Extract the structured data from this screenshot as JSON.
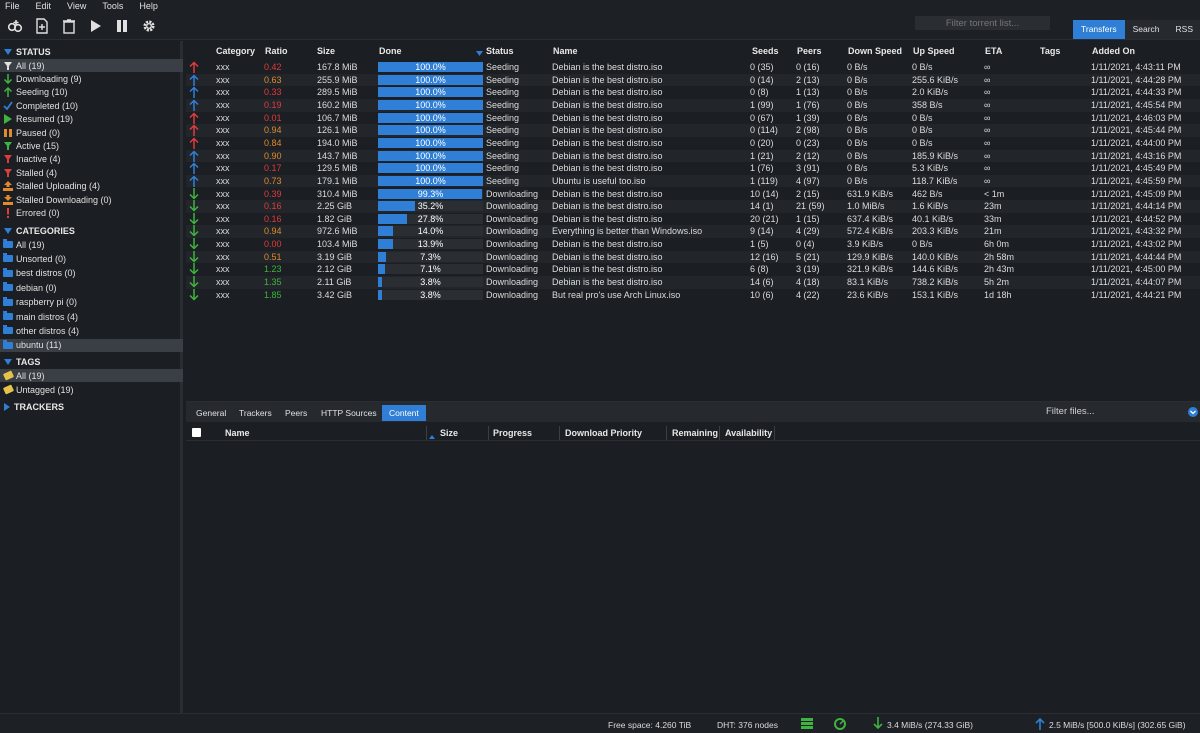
{
  "menu": [
    "File",
    "Edit",
    "View",
    "Tools",
    "Help"
  ],
  "toolbar": {
    "icons": [
      "add-link-icon",
      "add-file-icon",
      "delete-icon",
      "play-icon",
      "pause-icon",
      "settings-icon"
    ],
    "filter_placeholder": "Filter torrent list...",
    "tabs": [
      "Transfers",
      "Search",
      "RSS"
    ],
    "active_tab": "Transfers"
  },
  "sidebar": {
    "status_header": "STATUS",
    "status": [
      {
        "label": "All (19)",
        "icon": "filter-icon",
        "color": "#e0e0e0",
        "selected": true
      },
      {
        "label": "Downloading (9)",
        "icon": "arrow-down-icon",
        "color": "#3fb33f"
      },
      {
        "label": "Seeding (10)",
        "icon": "arrow-up-icon",
        "color": "#3fb33f"
      },
      {
        "label": "Completed (10)",
        "icon": "check-icon",
        "color": "#2f7fd6"
      },
      {
        "label": "Resumed (19)",
        "icon": "play-icon",
        "color": "#3fb33f"
      },
      {
        "label": "Paused (0)",
        "icon": "pause-icon",
        "color": "#e08a2b"
      },
      {
        "label": "Active (15)",
        "icon": "filter-icon",
        "color": "#3fb33f"
      },
      {
        "label": "Inactive (4)",
        "icon": "filter-icon",
        "color": "#e03c3c"
      },
      {
        "label": "Stalled (4)",
        "icon": "filter-icon",
        "color": "#e03c3c"
      },
      {
        "label": "Stalled Uploading (4)",
        "icon": "stalled-up-icon",
        "color": "#e08a2b"
      },
      {
        "label": "Stalled Downloading (0)",
        "icon": "stalled-down-icon",
        "color": "#e08a2b"
      },
      {
        "label": "Errored (0)",
        "icon": "error-icon",
        "color": "#e03c3c"
      }
    ],
    "categories_header": "CATEGORIES",
    "categories": [
      {
        "label": "All (19)"
      },
      {
        "label": "Unsorted (0)"
      },
      {
        "label": "best distros (0)"
      },
      {
        "label": "debian (0)"
      },
      {
        "label": "raspberry pi (0)"
      },
      {
        "label": "main distros (4)"
      },
      {
        "label": "other distros (4)"
      },
      {
        "label": "ubuntu (11)",
        "selected": true
      }
    ],
    "tags_header": "TAGS",
    "tags": [
      {
        "label": "All (19)",
        "selected": true
      },
      {
        "label": "Untagged (19)"
      }
    ],
    "trackers_header": "TRACKERS"
  },
  "table": {
    "headers": [
      "Category",
      "Ratio",
      "Size",
      "Done",
      "Status",
      "Name",
      "Seeds",
      "Peers",
      "Down Speed",
      "Up Speed",
      "ETA",
      "Tags",
      "Added On"
    ],
    "rows": [
      {
        "dir": "up",
        "arrow": "#e03c3c",
        "cat": "xxx",
        "ratio": "0.42",
        "rc": "#e03c3c",
        "size": "167.8 MiB",
        "done": 100.0,
        "done_t": "100.0%",
        "status": "Seeding",
        "name": "Debian is the best distro.iso",
        "seeds": "0 (35)",
        "peers": "0 (16)",
        "down": "0 B/s",
        "up": "0 B/s",
        "eta": "∞",
        "added": "1/11/2021, 4:43:11 PM"
      },
      {
        "dir": "up",
        "arrow": "#2f7fd6",
        "cat": "xxx",
        "ratio": "0.63",
        "rc": "#e08a2b",
        "size": "255.9 MiB",
        "done": 100.0,
        "done_t": "100.0%",
        "status": "Seeding",
        "name": "Debian is the best distro.iso",
        "seeds": "0 (14)",
        "peers": "2 (13)",
        "down": "0 B/s",
        "up": "255.6 KiB/s",
        "eta": "∞",
        "added": "1/11/2021, 4:44:28 PM"
      },
      {
        "dir": "up",
        "arrow": "#2f7fd6",
        "cat": "xxx",
        "ratio": "0.33",
        "rc": "#e03c3c",
        "size": "289.5 MiB",
        "done": 100.0,
        "done_t": "100.0%",
        "status": "Seeding",
        "name": "Debian is the best distro.iso",
        "seeds": "0 (8)",
        "peers": "1 (13)",
        "down": "0 B/s",
        "up": "2.0 KiB/s",
        "eta": "∞",
        "added": "1/11/2021, 4:44:33 PM"
      },
      {
        "dir": "up",
        "arrow": "#2f7fd6",
        "cat": "xxx",
        "ratio": "0.19",
        "rc": "#e03c3c",
        "size": "160.2 MiB",
        "done": 100.0,
        "done_t": "100.0%",
        "status": "Seeding",
        "name": "Debian is the best distro.iso",
        "seeds": "1 (99)",
        "peers": "1 (76)",
        "down": "0 B/s",
        "up": "358 B/s",
        "eta": "∞",
        "added": "1/11/2021, 4:45:54 PM"
      },
      {
        "dir": "up",
        "arrow": "#e03c3c",
        "cat": "xxx",
        "ratio": "0.01",
        "rc": "#e03c3c",
        "size": "106.7 MiB",
        "done": 100.0,
        "done_t": "100.0%",
        "status": "Seeding",
        "name": "Debian is the best distro.iso",
        "seeds": "0 (67)",
        "peers": "1 (39)",
        "down": "0 B/s",
        "up": "0 B/s",
        "eta": "∞",
        "added": "1/11/2021, 4:46:03 PM"
      },
      {
        "dir": "up",
        "arrow": "#e03c3c",
        "cat": "xxx",
        "ratio": "0.94",
        "rc": "#e08a2b",
        "size": "126.1 MiB",
        "done": 100.0,
        "done_t": "100.0%",
        "status": "Seeding",
        "name": "Debian is the best distro.iso",
        "seeds": "0 (114)",
        "peers": "2 (98)",
        "down": "0 B/s",
        "up": "0 B/s",
        "eta": "∞",
        "added": "1/11/2021, 4:45:44 PM"
      },
      {
        "dir": "up",
        "arrow": "#e03c3c",
        "cat": "xxx",
        "ratio": "0.84",
        "rc": "#e08a2b",
        "size": "194.0 MiB",
        "done": 100.0,
        "done_t": "100.0%",
        "status": "Seeding",
        "name": "Debian is the best distro.iso",
        "seeds": "0 (20)",
        "peers": "0 (23)",
        "down": "0 B/s",
        "up": "0 B/s",
        "eta": "∞",
        "added": "1/11/2021, 4:44:00 PM"
      },
      {
        "dir": "up",
        "arrow": "#2f7fd6",
        "cat": "xxx",
        "ratio": "0.90",
        "rc": "#e08a2b",
        "size": "143.7 MiB",
        "done": 100.0,
        "done_t": "100.0%",
        "status": "Seeding",
        "name": "Debian is the best distro.iso",
        "seeds": "1 (21)",
        "peers": "2 (12)",
        "down": "0 B/s",
        "up": "185.9 KiB/s",
        "eta": "∞",
        "added": "1/11/2021, 4:43:16 PM"
      },
      {
        "dir": "up",
        "arrow": "#2f7fd6",
        "cat": "xxx",
        "ratio": "0.17",
        "rc": "#e03c3c",
        "size": "129.5 MiB",
        "done": 100.0,
        "done_t": "100.0%",
        "status": "Seeding",
        "name": "Debian is the best distro.iso",
        "seeds": "1 (76)",
        "peers": "3 (91)",
        "down": "0 B/s",
        "up": "5.3 KiB/s",
        "eta": "∞",
        "added": "1/11/2021, 4:45:49 PM"
      },
      {
        "dir": "up",
        "arrow": "#2f7fd6",
        "cat": "xxx",
        "ratio": "0.73",
        "rc": "#e08a2b",
        "size": "179.1 MiB",
        "done": 100.0,
        "done_t": "100.0%",
        "status": "Seeding",
        "name": "Ubuntu is useful too.iso",
        "seeds": "1 (119)",
        "peers": "4 (97)",
        "down": "0 B/s",
        "up": "118.7 KiB/s",
        "eta": "∞",
        "added": "1/11/2021, 4:45:59 PM"
      },
      {
        "dir": "down",
        "arrow": "#3fb33f",
        "cat": "xxx",
        "ratio": "0.39",
        "rc": "#e03c3c",
        "size": "310.4 MiB",
        "done": 99.3,
        "done_t": "99.3%",
        "status": "Downloading",
        "name": "Debian is the best distro.iso",
        "seeds": "10 (14)",
        "peers": "2 (15)",
        "down": "631.9 KiB/s",
        "up": "462 B/s",
        "eta": "< 1m",
        "added": "1/11/2021, 4:45:09 PM"
      },
      {
        "dir": "down",
        "arrow": "#3fb33f",
        "cat": "xxx",
        "ratio": "0.16",
        "rc": "#e03c3c",
        "size": "2.25 GiB",
        "done": 35.2,
        "done_t": "35.2%",
        "status": "Downloading",
        "name": "Debian is the best distro.iso",
        "seeds": "14 (1)",
        "peers": "21 (59)",
        "down": "1.0 MiB/s",
        "up": "1.6 KiB/s",
        "eta": "23m",
        "added": "1/11/2021, 4:44:14 PM"
      },
      {
        "dir": "down",
        "arrow": "#3fb33f",
        "cat": "xxx",
        "ratio": "0.16",
        "rc": "#e03c3c",
        "size": "1.82 GiB",
        "done": 27.8,
        "done_t": "27.8%",
        "status": "Downloading",
        "name": "Debian is the best distro.iso",
        "seeds": "20 (21)",
        "peers": "1 (15)",
        "down": "637.4 KiB/s",
        "up": "40.1 KiB/s",
        "eta": "33m",
        "added": "1/11/2021, 4:44:52 PM"
      },
      {
        "dir": "down",
        "arrow": "#3fb33f",
        "cat": "xxx",
        "ratio": "0.94",
        "rc": "#e08a2b",
        "size": "972.6 MiB",
        "done": 14.0,
        "done_t": "14.0%",
        "status": "Downloading",
        "name": "Everything is better than Windows.iso",
        "seeds": "9 (14)",
        "peers": "4 (29)",
        "down": "572.4 KiB/s",
        "up": "203.3 KiB/s",
        "eta": "21m",
        "added": "1/11/2021, 4:43:32 PM"
      },
      {
        "dir": "down",
        "arrow": "#3fb33f",
        "cat": "xxx",
        "ratio": "0.00",
        "rc": "#e03c3c",
        "size": "103.4 MiB",
        "done": 13.9,
        "done_t": "13.9%",
        "status": "Downloading",
        "name": "Debian is the best distro.iso",
        "seeds": "1 (5)",
        "peers": "0 (4)",
        "down": "3.9 KiB/s",
        "up": "0 B/s",
        "eta": "6h 0m",
        "added": "1/11/2021, 4:43:02 PM"
      },
      {
        "dir": "down",
        "arrow": "#3fb33f",
        "cat": "xxx",
        "ratio": "0.51",
        "rc": "#e08a2b",
        "size": "3.19 GiB",
        "done": 7.3,
        "done_t": "7.3%",
        "status": "Downloading",
        "name": "Debian is the best distro.iso",
        "seeds": "12 (16)",
        "peers": "5 (21)",
        "down": "129.9 KiB/s",
        "up": "140.0 KiB/s",
        "eta": "2h 58m",
        "added": "1/11/2021, 4:44:44 PM"
      },
      {
        "dir": "down",
        "arrow": "#3fb33f",
        "cat": "xxx",
        "ratio": "1.23",
        "rc": "#3fb33f",
        "size": "2.12 GiB",
        "done": 7.1,
        "done_t": "7.1%",
        "status": "Downloading",
        "name": "Debian is the best distro.iso",
        "seeds": "6 (8)",
        "peers": "3 (19)",
        "down": "321.9 KiB/s",
        "up": "144.6 KiB/s",
        "eta": "2h 43m",
        "added": "1/11/2021, 4:45:00 PM"
      },
      {
        "dir": "down",
        "arrow": "#3fb33f",
        "cat": "xxx",
        "ratio": "1.35",
        "rc": "#3fb33f",
        "size": "2.11 GiB",
        "done": 3.8,
        "done_t": "3.8%",
        "status": "Downloading",
        "name": "Debian is the best distro.iso",
        "seeds": "14 (6)",
        "peers": "4 (18)",
        "down": "83.1 KiB/s",
        "up": "738.2 KiB/s",
        "eta": "5h 2m",
        "added": "1/11/2021, 4:44:07 PM"
      },
      {
        "dir": "down",
        "arrow": "#3fb33f",
        "cat": "xxx",
        "ratio": "1.85",
        "rc": "#3fb33f",
        "size": "3.42 GiB",
        "done": 3.8,
        "done_t": "3.8%",
        "status": "Downloading",
        "name": "But real pro's use Arch Linux.iso",
        "seeds": "10 (6)",
        "peers": "4 (22)",
        "down": "23.6 KiB/s",
        "up": "153.1 KiB/s",
        "eta": "1d 18h",
        "added": "1/11/2021, 4:44:21 PM"
      }
    ]
  },
  "details": {
    "tabs": [
      "General",
      "Trackers",
      "Peers",
      "HTTP Sources",
      "Content"
    ],
    "active_tab": "Content",
    "filter_files_placeholder": "Filter files...",
    "columns": [
      "Name",
      "Size",
      "Progress",
      "Download Priority",
      "Remaining",
      "Availability"
    ]
  },
  "statusbar": {
    "free_space": "Free space: 4.260 TiB",
    "dht": "DHT: 376 nodes",
    "download": "3.4 MiB/s (274.33 GiB)",
    "upload": "2.5 MiB/s [500.0 KiB/s] (302.65 GiB)"
  },
  "colors": {
    "accent": "#2f7fd6",
    "red": "#e03c3c",
    "orange": "#e08a2b",
    "green": "#3fb33f"
  }
}
